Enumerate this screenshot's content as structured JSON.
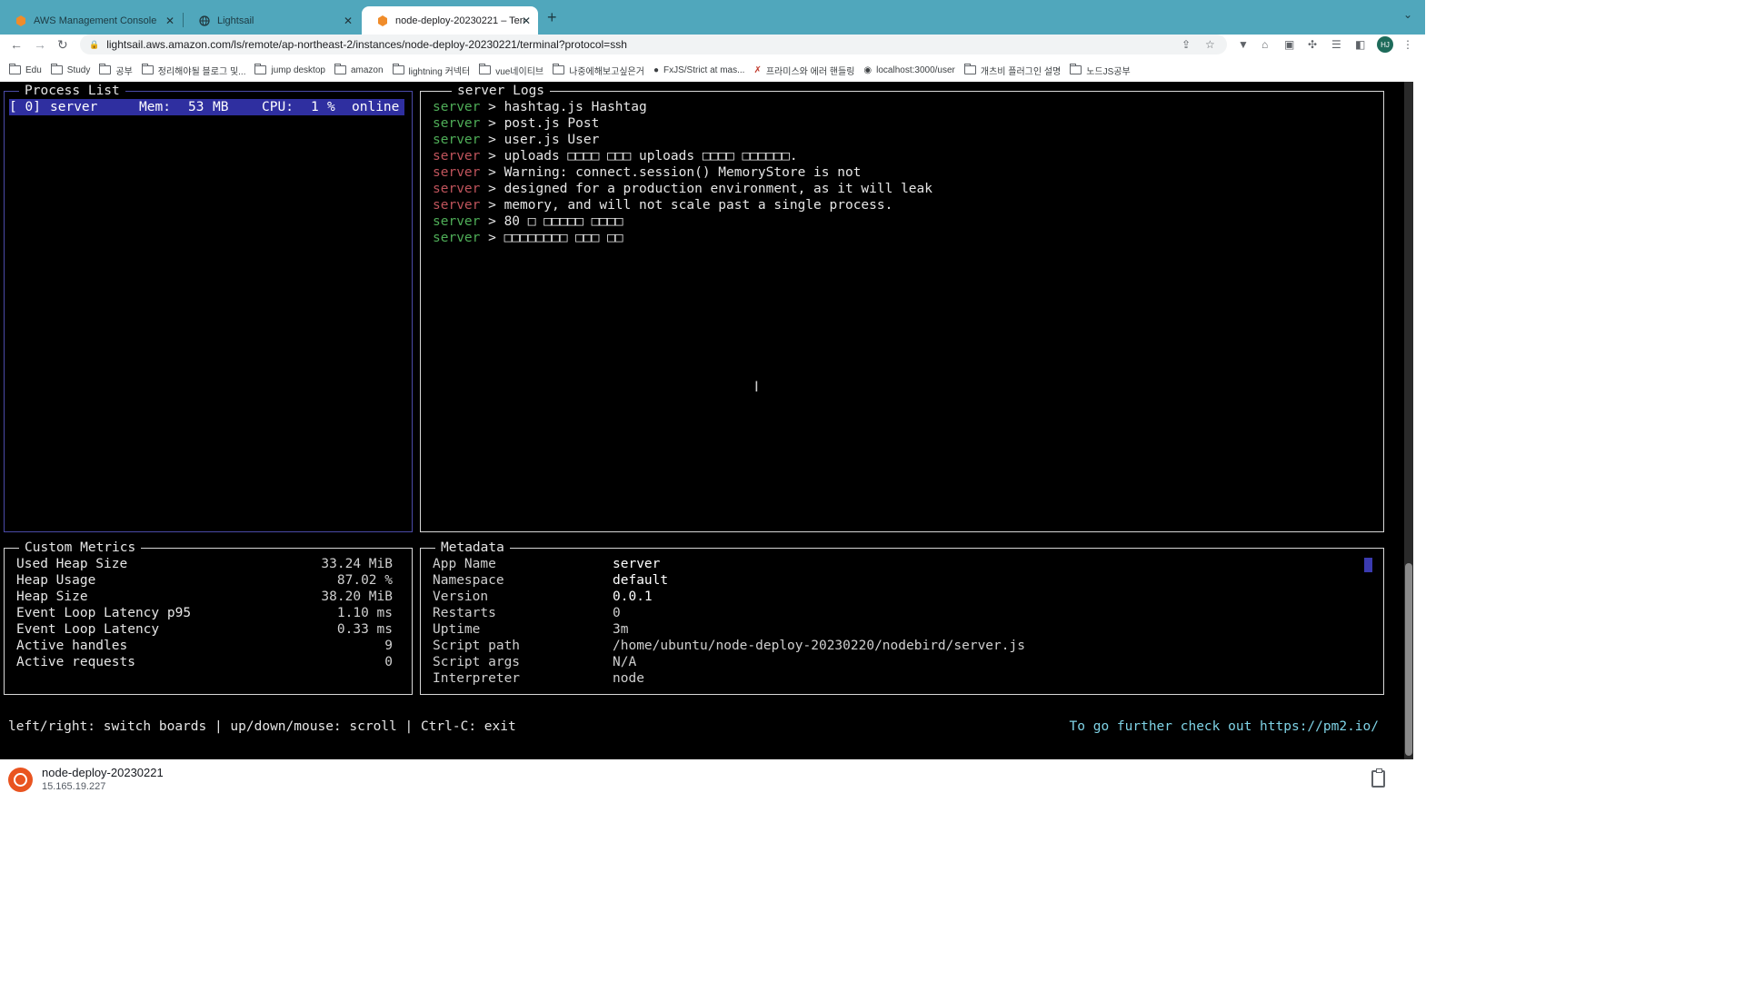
{
  "browser": {
    "tabs": [
      {
        "title": "AWS Management Console",
        "active": false
      },
      {
        "title": "Lightsail",
        "active": false
      },
      {
        "title": "node-deploy-20230221 – Term",
        "active": true
      }
    ],
    "url": "lightsail.aws.amazon.com/ls/remote/ap-northeast-2/instances/node-deploy-20230221/terminal?protocol=ssh",
    "avatar_initials": "HJ",
    "bookmarks": [
      "Edu",
      "Study",
      "공부",
      "정리해야될 블로그 및...",
      "jump desktop",
      "amazon",
      "lightning 커넥터",
      "vue네이티브",
      "나중에해보고싶은거",
      "FxJS/Strict at mas...",
      "프라미스와 에러 핸들링",
      "localhost:3000/user",
      "개츠비 플러그인 설명",
      "노드JS공부"
    ]
  },
  "terminal": {
    "process_list": {
      "title": "Process List",
      "row": {
        "id": "[ 0]",
        "name": "server",
        "mem_label": "Mem:",
        "mem_value": "53",
        "mem_unit": "MB",
        "cpu_label": "CPU:",
        "cpu_value": "1",
        "cpu_unit": "%",
        "status": "online"
      }
    },
    "logs": {
      "title": "server Logs",
      "lines": [
        {
          "src": "server",
          "text": " > hashtag.js Hashtag",
          "color": "green"
        },
        {
          "src": "server",
          "text": " > post.js Post",
          "color": "green"
        },
        {
          "src": "server",
          "text": " > user.js User",
          "color": "green"
        },
        {
          "src": "server",
          "text": " > uploads □□□□ □□□ uploads □□□□ □□□□□□.",
          "color": "red"
        },
        {
          "src": "server",
          "text": " > Warning: connect.session() MemoryStore is not",
          "color": "red"
        },
        {
          "src": "server",
          "text": " > designed for a production environment, as it will leak",
          "color": "red"
        },
        {
          "src": "server",
          "text": " > memory, and will not scale past a single process.",
          "color": "red"
        },
        {
          "src": "server",
          "text": " > 80 □ □□□□□ □□□□",
          "color": "green"
        },
        {
          "src": "server",
          "text": " > □□□□□□□□ □□□ □□",
          "color": "green"
        }
      ]
    },
    "metrics": {
      "title": "Custom Metrics",
      "rows": [
        {
          "label": "Used Heap Size",
          "value": "33.24 MiB"
        },
        {
          "label": "Heap Usage",
          "value": "87.02 %"
        },
        {
          "label": "Heap Size",
          "value": "38.20 MiB"
        },
        {
          "label": "Event Loop Latency p95",
          "value": "1.10 ms"
        },
        {
          "label": "Event Loop Latency",
          "value": "0.33 ms"
        },
        {
          "label": "Active handles",
          "value": "9"
        },
        {
          "label": "Active requests",
          "value": "0"
        }
      ]
    },
    "metadata": {
      "title": "Metadata",
      "rows": [
        {
          "label": "App Name",
          "value": "server"
        },
        {
          "label": "Namespace",
          "value": "default"
        },
        {
          "label": "Version",
          "value": "0.0.1"
        },
        {
          "label": "Restarts",
          "value": "0"
        },
        {
          "label": "Uptime",
          "value": "3m"
        },
        {
          "label": "Script path",
          "value": "/home/ubuntu/node-deploy-20230220/nodebird/server.js"
        },
        {
          "label": "Script args",
          "value": "N/A"
        },
        {
          "label": "Interpreter",
          "value": "node"
        }
      ]
    },
    "help_text": "left/right: switch boards | up/down/mouse: scroll | Ctrl-C: exit",
    "further_text": "To go further check out https://pm2.io/"
  },
  "instance": {
    "name": "node-deploy-20230221",
    "ip": "15.165.19.227"
  },
  "colors": {
    "tabbar": "#50a7bc",
    "terminal_bg": "#000000",
    "selection": "#2f2fa0",
    "log_green": "#4fae58",
    "log_red": "#c0545c",
    "link_cyan": "#7fd3e6",
    "ubuntu_orange": "#e95420"
  }
}
